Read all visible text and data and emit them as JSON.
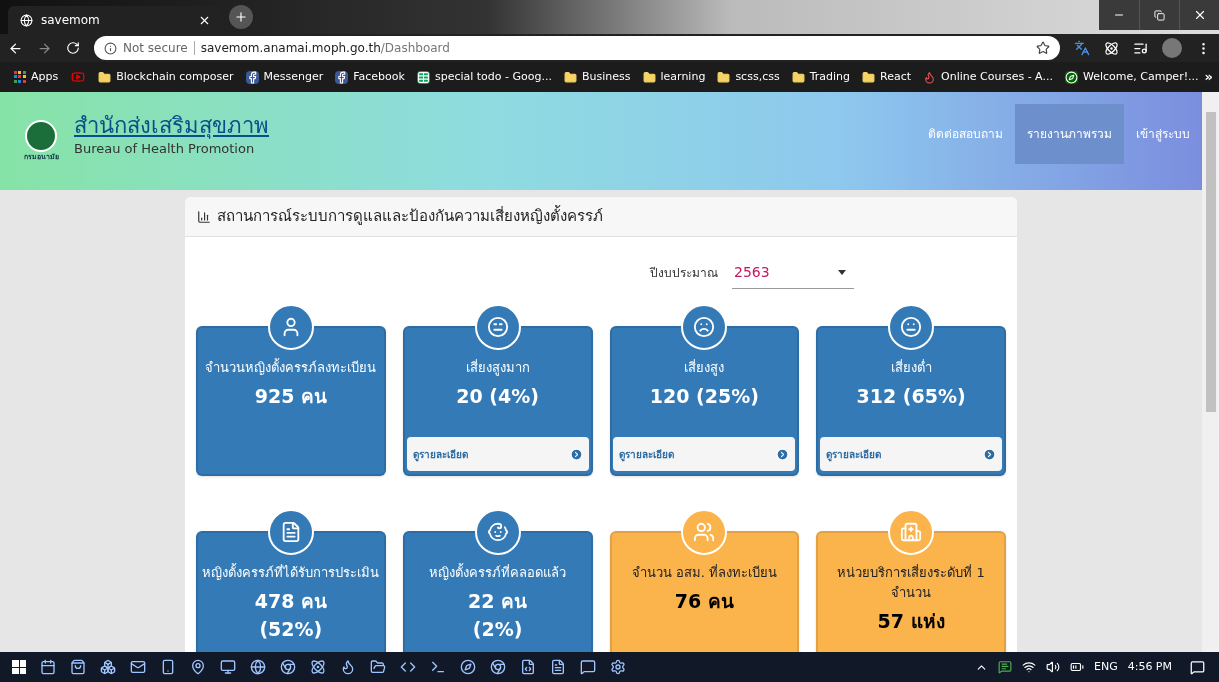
{
  "browser": {
    "tab": {
      "title": "savemom"
    },
    "address": {
      "security": "Not secure",
      "host": "savemom.anamai.moph.go.th",
      "path": "/Dashboard"
    },
    "bookmarks": [
      {
        "kind": "apps",
        "label": "Apps"
      },
      {
        "kind": "video"
      },
      {
        "kind": "folder",
        "label": "Blockchain composer"
      },
      {
        "kind": "social",
        "label": "Messenger"
      },
      {
        "kind": "social",
        "label": "Facebook"
      },
      {
        "kind": "sheet",
        "label": "special todo - Goog..."
      },
      {
        "kind": "folder",
        "label": "Business"
      },
      {
        "kind": "folder",
        "label": "learning"
      },
      {
        "kind": "folder",
        "label": "scss,css"
      },
      {
        "kind": "folder",
        "label": "Trading"
      },
      {
        "kind": "folder",
        "label": "React"
      },
      {
        "kind": "course",
        "label": "Online Courses - A..."
      },
      {
        "kind": "camp",
        "label": "Welcome, Camper!..."
      }
    ],
    "more": "»"
  },
  "header": {
    "logo_caption": "กรมอนามัย",
    "title": "สำนักส่งเสริมสุขภาพ",
    "subtitle": "Bureau of Health Promotion",
    "nav": [
      {
        "label": "ติดต่อสอบถาม",
        "selected": false
      },
      {
        "label": "รายงานภาพรวม",
        "selected": true
      },
      {
        "label": "เข้าสู่ระบบ",
        "selected": false
      }
    ]
  },
  "panel": {
    "title": "สถานการณ์ระบบการดูแลและป้องกันความเสี่ยงหญิงตั้งครรภ์",
    "filter": {
      "label": "ปีงบประมาณ",
      "value": "2563"
    },
    "cards": [
      {
        "color": "#337ab7",
        "label": [
          "จำนวนหญิงตั้งครรภ์ลงทะเบียน"
        ],
        "values": [
          "925 คน"
        ]
      },
      {
        "color": "#337ab7",
        "label": [
          "เสี่ยงสูงมาก"
        ],
        "values": [
          "20 (4%)"
        ],
        "link": "ดูรายละเอียด"
      },
      {
        "color": "#337ab7",
        "label": [
          "เสี่ยงสูง"
        ],
        "values": [
          "120 (25%)"
        ],
        "link": "ดูรายละเอียด"
      },
      {
        "color": "#337ab7",
        "label": [
          "เสี่ยงต่ำ"
        ],
        "values": [
          "312 (65%)"
        ],
        "link": "ดูรายละเอียด"
      },
      {
        "color": "#337ab7",
        "label": [
          "หญิงตั้งครรภ์ที่ได้รับการประเมิน"
        ],
        "values": [
          "478 คน",
          "(52%)"
        ]
      },
      {
        "color": "#337ab7",
        "label": [
          "หญิงตั้งครรภ์ที่คลอดแล้ว"
        ],
        "values": [
          "22 คน",
          "(2%)"
        ]
      },
      {
        "color": "#fbb34c",
        "label": [
          "จำนวน อสม. ที่ลงทะเบียน"
        ],
        "values": [
          "76 คน"
        ]
      },
      {
        "color": "#fbb34c",
        "label": [
          "หน่วยบริการเสี่ยงระดับที่ 1",
          "จำนวน"
        ],
        "values": [
          "57 แห่ง"
        ]
      }
    ]
  },
  "taskbar": {
    "language": "ENG",
    "time": "4:56 PM"
  }
}
